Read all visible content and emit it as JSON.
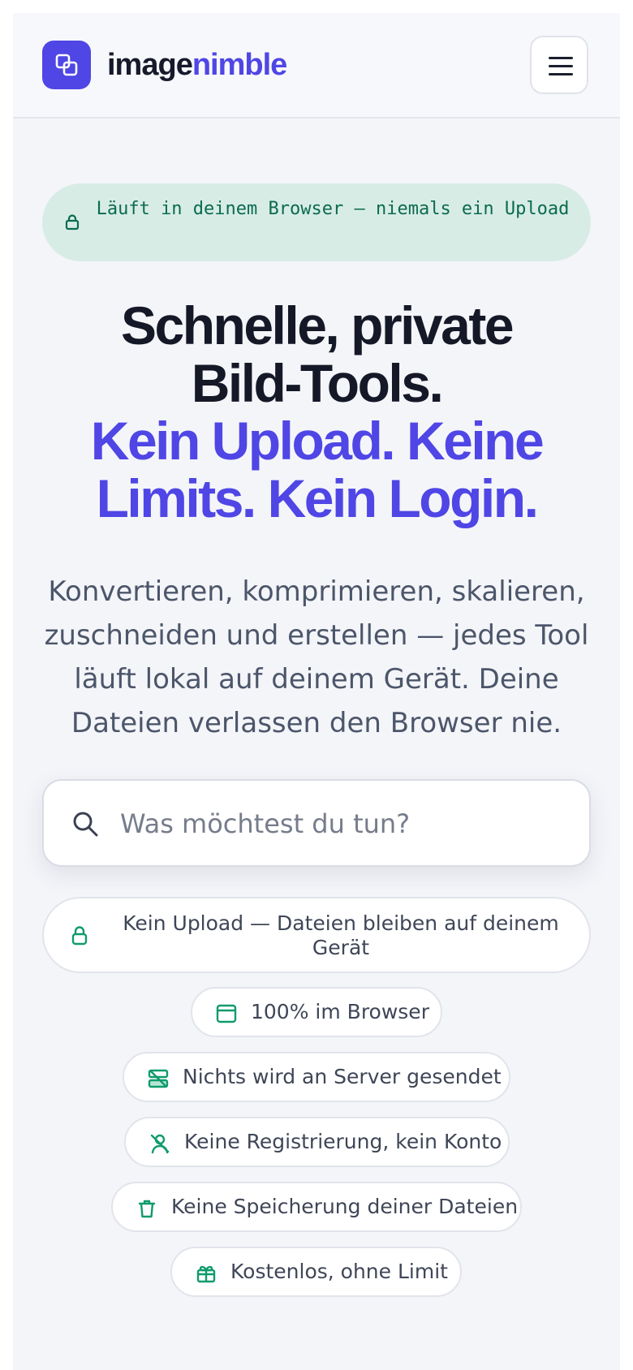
{
  "brand": {
    "name_part1": "image",
    "name_part2": "nimble",
    "accent": "#4f46e5"
  },
  "header": {
    "menu_label": "Menu"
  },
  "privacy_pill": {
    "text": "Läuft in deinem Browser — niemals ein Upload"
  },
  "hero": {
    "headline_line1": "Schnelle, private",
    "headline_line2": "Bild-Tools.",
    "headline_accent1": "Kein Upload. Keine",
    "headline_accent2": "Limits. Kein Login.",
    "description": "Konvertieren, komprimieren, skalieren, zuschneiden und erstellen — jedes Tool läuft lokal auf deinem Gerät. Deine Dateien verlassen den Browser nie."
  },
  "search": {
    "placeholder": "Was möchtest du tun?"
  },
  "features": [
    {
      "label": "Kein Upload — Dateien bleiben auf deinem Gerät",
      "icon": "lock-icon"
    },
    {
      "label": "100% im Browser",
      "icon": "browser-window-icon"
    },
    {
      "label": "Nichts wird an Server gesendet",
      "icon": "server-off-icon"
    },
    {
      "label": "Keine Registrierung, kein Konto",
      "icon": "user-off-icon"
    },
    {
      "label": "Keine Speicherung deiner Dateien",
      "icon": "trash-icon"
    },
    {
      "label": "Kostenlos, ohne Limit",
      "icon": "gift-icon"
    }
  ],
  "colors": {
    "accent": "#4f46e5",
    "success": "#0f9b6c",
    "pill_bg": "#d8ece6",
    "text_dark": "#151827"
  }
}
